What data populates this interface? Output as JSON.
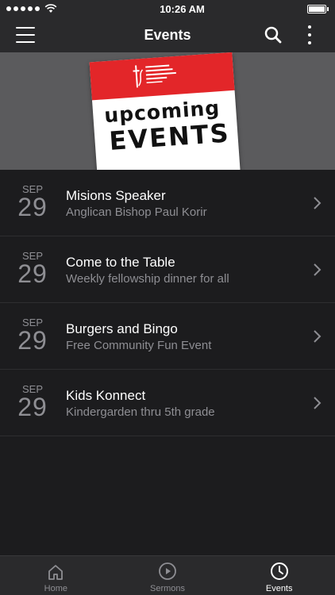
{
  "status_bar": {
    "time": "10:26 AM"
  },
  "nav": {
    "title": "Events"
  },
  "banner": {
    "poster_line1": "upcoming",
    "poster_line2": "EVENTS",
    "brand_color": "#e32629"
  },
  "events": [
    {
      "month": "SEP",
      "day": "29",
      "title": "Misions Speaker",
      "subtitle": "Anglican Bishop Paul Korir"
    },
    {
      "month": "SEP",
      "day": "29",
      "title": "Come to the Table",
      "subtitle": "Weekly fellowship dinner for all"
    },
    {
      "month": "SEP",
      "day": "29",
      "title": "Burgers and Bingo",
      "subtitle": "Free Community Fun Event"
    },
    {
      "month": "SEP",
      "day": "29",
      "title": "Kids Konnect",
      "subtitle": "Kindergarden thru 5th grade"
    }
  ],
  "tabs": [
    {
      "label": "Home",
      "icon": "home-icon"
    },
    {
      "label": "Sermons",
      "icon": "play-icon"
    },
    {
      "label": "Events",
      "icon": "clock-icon",
      "active": true
    }
  ]
}
